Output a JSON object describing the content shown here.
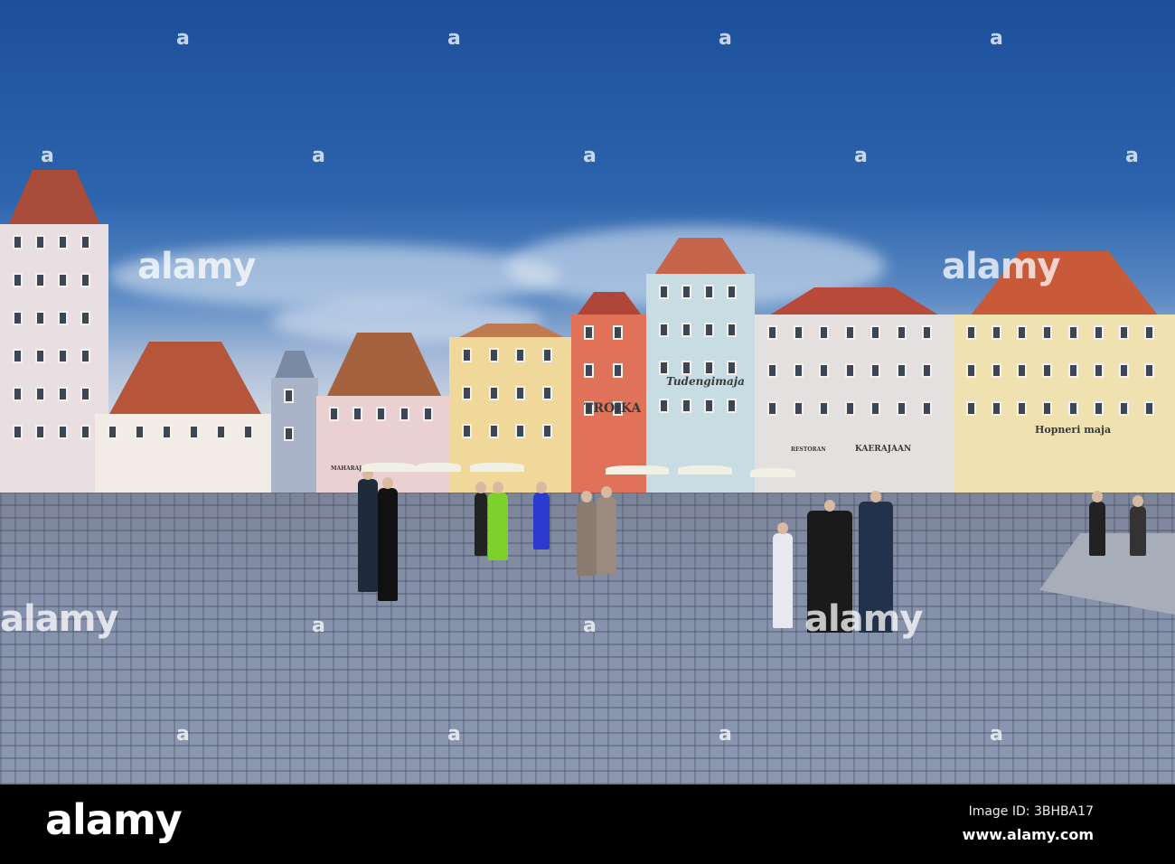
{
  "photo": {
    "description_signs": {
      "tudengimaja": "Tudengimaja",
      "troika": "TROIKA",
      "restoran": "RESTORAN",
      "kaerajaan": "KAERAJAAN",
      "hopneri": "Hopneri maja",
      "maharaja": "MAHARAJA"
    },
    "colors": {
      "sky": "#2c64ad",
      "cobble": "#8692ab"
    }
  },
  "watermark": {
    "text": "alamy",
    "small": "a"
  },
  "footer": {
    "logo": "alamy",
    "image_id": "Image ID: 3BHBA17",
    "site": "www.alamy.com"
  }
}
